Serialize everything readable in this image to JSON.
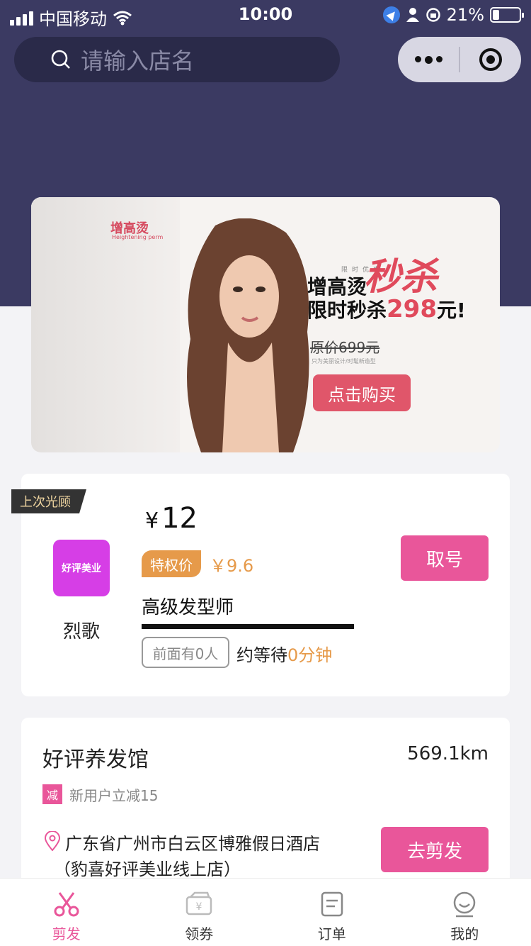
{
  "status_bar": {
    "carrier": "中国移动",
    "time": "10:00",
    "battery": "21%"
  },
  "search": {
    "placeholder": "请输入店名"
  },
  "banner": {
    "brand": "增高烫",
    "brand_sub": "Heightening perm",
    "tiny_label": "限时优惠",
    "line1": "增高烫",
    "seckill": "秒杀",
    "line2_prefix": "限时秒杀",
    "line2_price": "298",
    "line2_suffix": "元!",
    "original_price": "原价699元",
    "note": "只为美丽设计/时髦新造型",
    "buy_button": "点击购买"
  },
  "last_visit": {
    "tag": "上次光顾",
    "logo_text": "好评美业",
    "shop_name": "烈歌",
    "currency": "¥",
    "price": "12",
    "vip_label": "特权价",
    "vip_price": "￥9.6",
    "stylist": "高级发型师",
    "queue": "前面有0人",
    "wait_prefix": "约等待",
    "wait_value": "0分钟",
    "take_number_button": "取号"
  },
  "shop": {
    "name": "好评养发馆",
    "distance": "569.1km",
    "promo_tag": "减",
    "promo_text": "新用户立减15",
    "address": "广东省广州市白云区博雅假日酒店（豹喜好评美业线上店）",
    "go_button": "去剪发"
  },
  "tabs": [
    {
      "label": "剪发",
      "icon": "scissors-icon",
      "active": true
    },
    {
      "label": "领券",
      "icon": "coupon-icon",
      "active": false
    },
    {
      "label": "订单",
      "icon": "order-icon",
      "active": false
    },
    {
      "label": "我的",
      "icon": "profile-icon",
      "active": false
    }
  ],
  "colors": {
    "header_bg": "#3b3a62",
    "accent_pink": "#e9569a",
    "vip_orange": "#e69a4a",
    "banner_red": "#e04a5c"
  }
}
